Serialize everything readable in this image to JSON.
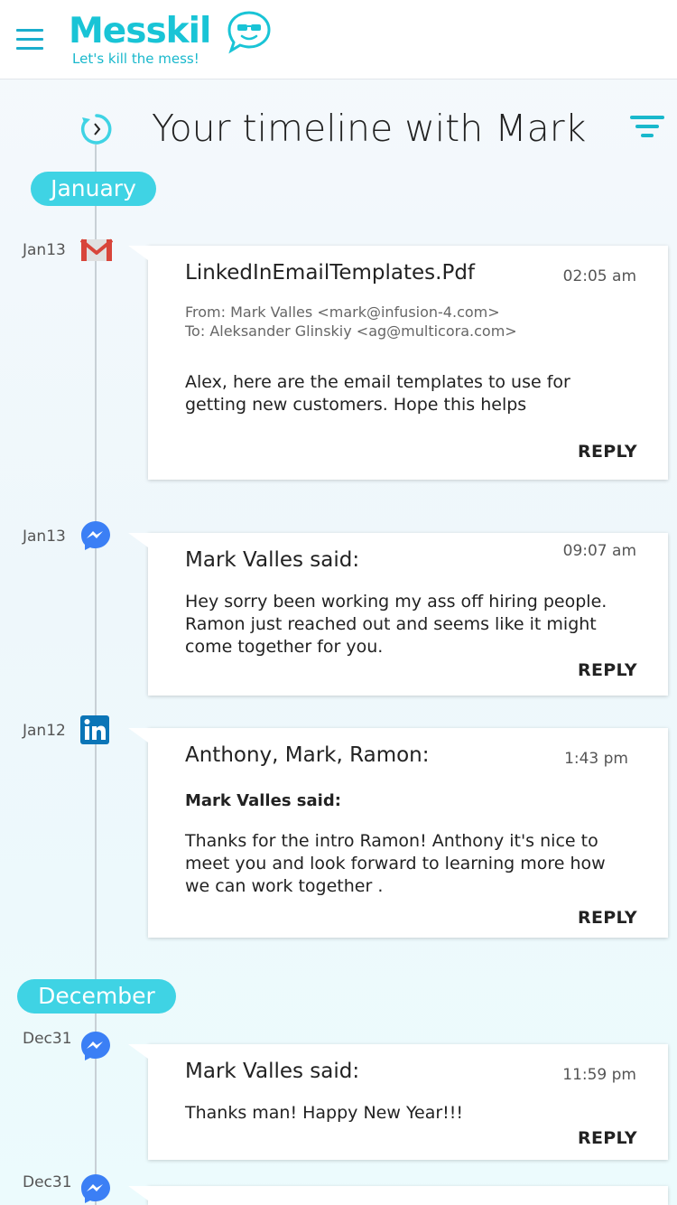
{
  "app": {
    "logo": "Messkil",
    "tagline": "Let's kill the mess!"
  },
  "header": {
    "title": "Your timeline with Mark"
  },
  "months": [
    "January",
    "December"
  ],
  "entries": [
    {
      "date": "Jan13",
      "source": "gmail-icon",
      "title": "LinkedInEmailTemplates.Pdf",
      "time": "02:05 am",
      "from": "From: Mark Valles <mark@infusion-4.com>",
      "to": "To: Aleksander Glinskiy <ag@multicora.com>",
      "body": "Alex, here are the email templates to use for getting new customers. Hope this helps",
      "reply": "REPLY"
    },
    {
      "date": "Jan13",
      "source": "messenger-icon",
      "title": "Mark Valles said:",
      "time": "09:07 am",
      "body": "Hey sorry been working my ass off hiring people. Ramon just reached out and seems like it might come together for you.",
      "reply": "REPLY"
    },
    {
      "date": "Jan12",
      "source": "linkedin-icon",
      "title": "Anthony, Mark, Ramon:",
      "time": "1:43 pm",
      "subhead": "Mark Valles said:",
      "body": "Thanks for the intro Ramon! Anthony it's nice to meet you and look forward to learning more how we can work together .",
      "reply": "REPLY"
    },
    {
      "date": "Dec31",
      "source": "messenger-icon",
      "title": "Mark Valles said:",
      "time": "11:59 pm",
      "body": "Thanks man! Happy New Year!!!",
      "reply": "REPLY"
    },
    {
      "date": "Dec31",
      "source": "messenger-icon"
    }
  ],
  "colors": {
    "accent": "#19c4d6",
    "month_pill": "#3fd3e4",
    "gmail_red": "#d8453a",
    "messenger_blue": "#3b7ff5",
    "linkedin_blue": "#0b75b7"
  }
}
